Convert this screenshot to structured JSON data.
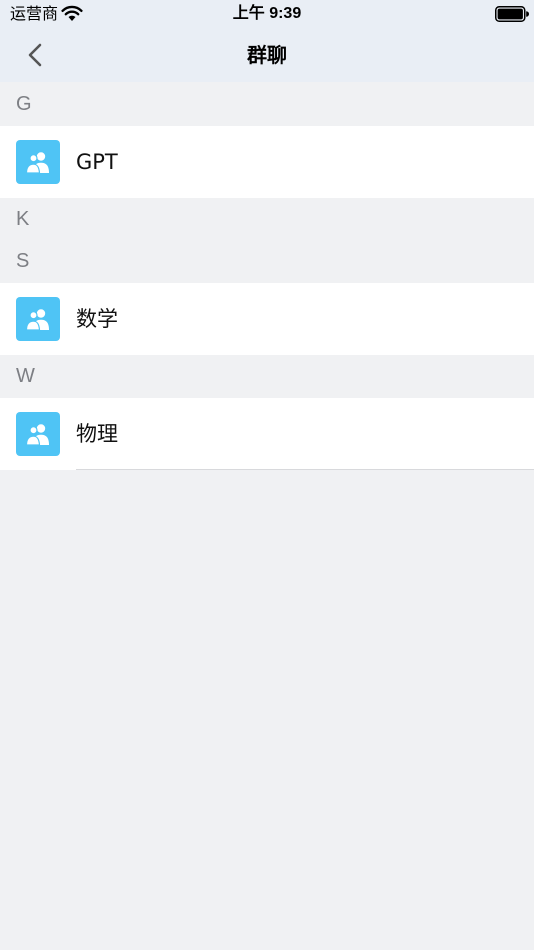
{
  "status_bar": {
    "carrier": "运营商",
    "time": "上午 9:39"
  },
  "nav": {
    "title": "群聊"
  },
  "sections": [
    {
      "letter": "G",
      "items": [
        {
          "name": "GPT"
        }
      ]
    },
    {
      "letter": "K",
      "items": []
    },
    {
      "letter": "S",
      "items": [
        {
          "name": "数学"
        }
      ]
    },
    {
      "letter": "W",
      "items": [
        {
          "name": "物理"
        }
      ]
    }
  ],
  "colors": {
    "avatar_bg": "#4fc4f5",
    "page_bg": "#f0f1f3",
    "nav_bg": "#e9eef5"
  },
  "icons": {
    "back": "chevron-left-icon",
    "group": "group-users-icon",
    "wifi": "wifi-icon",
    "battery": "battery-icon"
  }
}
